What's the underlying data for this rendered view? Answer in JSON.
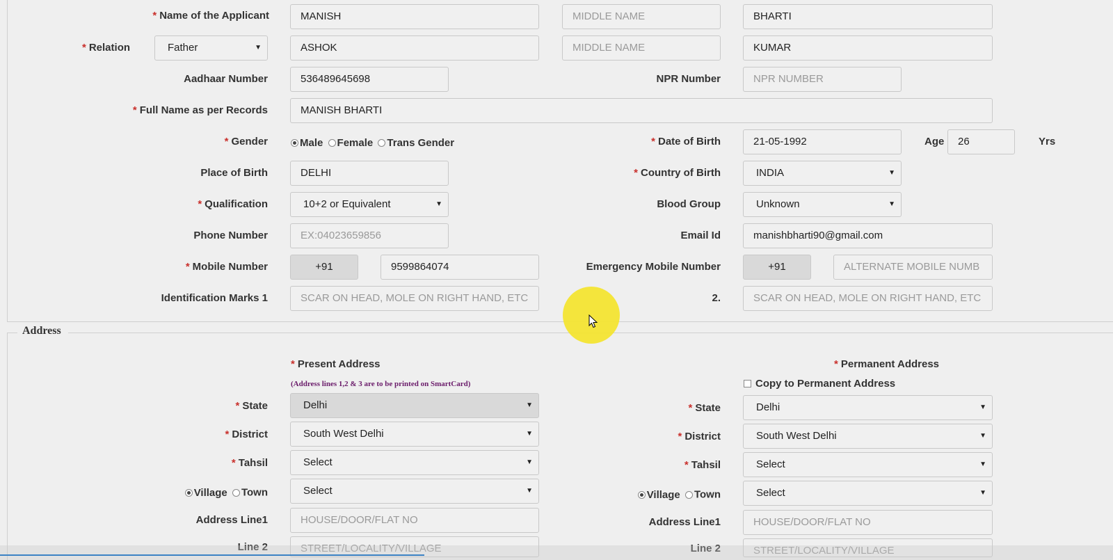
{
  "personal": {
    "name_label": "Name of the Applicant",
    "first_name": "MANISH",
    "middle_name_placeholder": "MIDDLE NAME",
    "last_name": "BHARTI",
    "relation_label": "Relation",
    "relation_value": "Father",
    "relation_first": "ASHOK",
    "relation_middle_placeholder": "MIDDLE NAME",
    "relation_last": "KUMAR",
    "aadhaar_label": "Aadhaar Number",
    "aadhaar_value": "536489645698",
    "npr_label": "NPR Number",
    "npr_placeholder": "NPR NUMBER",
    "fullname_label": "Full Name as per Records",
    "fullname_value": "MANISH BHARTI",
    "gender_label": "Gender",
    "gender_options": [
      "Male",
      "Female",
      "Trans Gender"
    ],
    "gender_selected": "Male",
    "dob_label": "Date of Birth",
    "dob_value": "21-05-1992",
    "age_label": "Age",
    "age_value": "26",
    "age_unit": "Yrs",
    "pob_label": "Place of Birth",
    "pob_value": "DELHI",
    "cob_label": "Country of Birth",
    "cob_value": "INDIA",
    "qual_label": "Qualification",
    "qual_value": "10+2 or Equivalent",
    "blood_label": "Blood Group",
    "blood_value": "Unknown",
    "phone_label": "Phone Number",
    "phone_placeholder": "EX:04023659856",
    "email_label": "Email Id",
    "email_value": "manishbharti90@gmail.com",
    "mobile_label": "Mobile Number",
    "mobile_code": "+91",
    "mobile_value": "9599864074",
    "emergency_label": "Emergency Mobile Number",
    "emergency_code": "+91",
    "emergency_placeholder": "ALTERNATE MOBILE NUMB",
    "idmark1_label": "Identification Marks 1",
    "idmark1_placeholder": "SCAR ON HEAD, MOLE ON RIGHT HAND, ETC",
    "idmark2_label": "2.",
    "idmark2_placeholder": "SCAR ON HEAD, MOLE ON RIGHT HAND, ETC"
  },
  "address": {
    "legend": "Address",
    "present_title": "Present Address",
    "present_note": "(Address lines 1,2 & 3 are to be printed on SmartCard)",
    "permanent_title": "Permanent Address",
    "copy_label": "Copy to Permanent Address",
    "state_label": "State",
    "district_label": "District",
    "tahsil_label": "Tahsil",
    "village_label": "Village",
    "town_label": "Town",
    "line1_label": "Address Line1",
    "line2_label": "Line 2",
    "present": {
      "state": "Delhi",
      "district": "South West Delhi",
      "tahsil": "Select",
      "village_town": "Select",
      "line1_placeholder": "HOUSE/DOOR/FLAT NO",
      "line2_placeholder": "STREET/LOCALITY/VILLAGE"
    },
    "permanent": {
      "state": "Delhi",
      "district": "South West Delhi",
      "tahsil": "Select",
      "village_town": "Select",
      "line1_placeholder": "HOUSE/DOOR/FLAT NO",
      "line2_placeholder": "STREET/LOCALITY/VILLAGE"
    }
  },
  "colors": {
    "required": "#c9302c",
    "cursor_highlight": "#f5e63a",
    "note": "#6a1b6a"
  }
}
